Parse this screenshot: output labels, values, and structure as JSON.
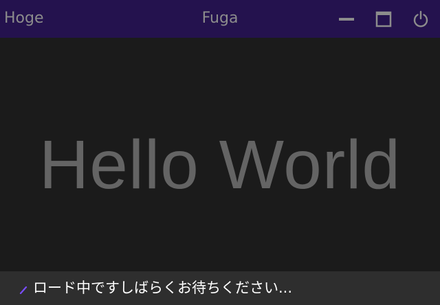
{
  "titlebar": {
    "app_name": "Hoge",
    "window_title": "Fuga",
    "controls": [
      "minimize-icon",
      "maximize-icon",
      "power-icon"
    ],
    "background": "#24124e"
  },
  "main": {
    "headline": "Hello World",
    "text_color": "#646464"
  },
  "status": {
    "text": "ロード中ですしばらくお待ちください...",
    "spinner_icon": "spinner-icon",
    "spinner_color": "#7a4dff"
  }
}
